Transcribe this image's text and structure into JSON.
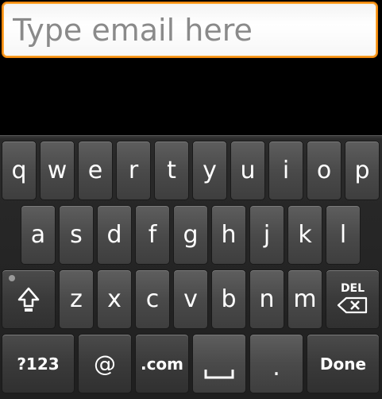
{
  "email_field": {
    "placeholder": "Type email here",
    "value": ""
  },
  "keyboard": {
    "row1": [
      "q",
      "w",
      "e",
      "r",
      "t",
      "y",
      "u",
      "i",
      "o",
      "p"
    ],
    "row2": [
      "a",
      "s",
      "d",
      "f",
      "g",
      "h",
      "j",
      "k",
      "l"
    ],
    "row3": [
      "z",
      "x",
      "c",
      "v",
      "b",
      "n",
      "m"
    ],
    "shift_icon": "shift-arrow-icon",
    "delete_label": "DEL",
    "delete_icon": "backspace-x-icon",
    "symbols_label": "?123",
    "at_label": "@",
    "dotcom_label": ".com",
    "space_icon": "space-bar-icon",
    "period_label": ".",
    "done_label": "Done"
  },
  "colors": {
    "focus_border": "#f08a10",
    "key_face": "#4a4a4a",
    "keyboard_bg": "#2a2a2a"
  }
}
